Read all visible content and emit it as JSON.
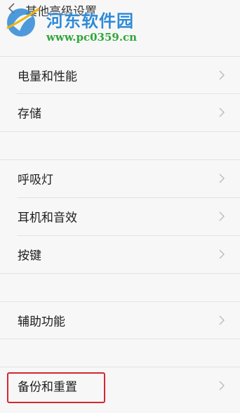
{
  "header": {
    "title": "其他高级设置",
    "back_icon": "chevron-left-icon"
  },
  "watermark": {
    "site_name": "河东软件园",
    "url": "www.pc0359.cn"
  },
  "settings": [
    {
      "label": "电量和性能"
    },
    {
      "label": "存储"
    },
    {
      "label": "呼吸灯"
    },
    {
      "label": "耳机和音效"
    },
    {
      "label": "按键"
    },
    {
      "label": "辅助功能"
    },
    {
      "label": "备份和重置",
      "highlighted": true
    }
  ],
  "colors": {
    "highlight_border": "#d6262f",
    "watermark_blue": "#2f8ad6",
    "watermark_green": "#2fa63a"
  }
}
